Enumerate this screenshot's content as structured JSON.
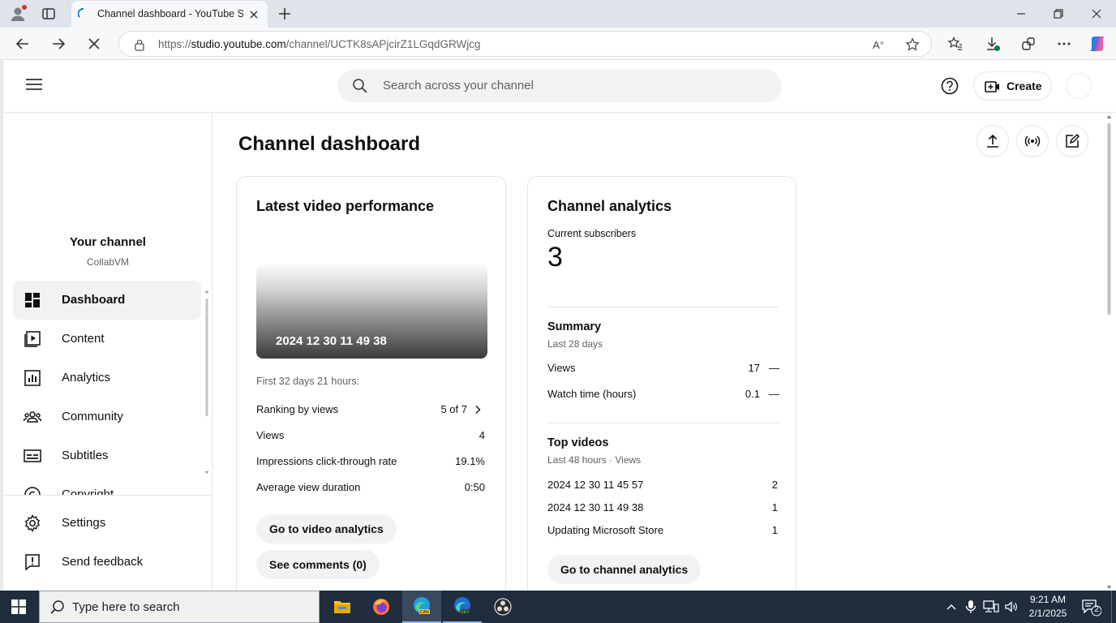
{
  "browser": {
    "tab_title": "Channel dashboard - YouTube Studio",
    "url_prefix": "https://",
    "url_host": "studio.youtube.com",
    "url_path": "/channel/UCTK8sAPjcirZ1LGqdGRWjcg"
  },
  "header": {
    "search_placeholder": "Search across your channel",
    "create_label": "Create"
  },
  "sidebar": {
    "channel_title": "Your channel",
    "channel_name": "CollabVM",
    "items": [
      {
        "label": "Dashboard",
        "icon": "dashboard-icon"
      },
      {
        "label": "Content",
        "icon": "content-icon"
      },
      {
        "label": "Analytics",
        "icon": "analytics-icon"
      },
      {
        "label": "Community",
        "icon": "community-icon"
      },
      {
        "label": "Subtitles",
        "icon": "subtitles-icon"
      },
      {
        "label": "Copyright",
        "icon": "copyright-icon"
      }
    ],
    "settings_label": "Settings",
    "feedback_label": "Send feedback"
  },
  "main": {
    "page_title": "Channel dashboard"
  },
  "latest_video": {
    "title": "Latest video performance",
    "video_title": "2024 12 30 11 49 38",
    "period": "First 32 days 21 hours:",
    "rows": [
      {
        "label": "Ranking by views",
        "value": "5 of 7"
      },
      {
        "label": "Views",
        "value": "4"
      },
      {
        "label": "Impressions click-through rate",
        "value": "19.1%"
      },
      {
        "label": "Average view duration",
        "value": "0:50"
      }
    ],
    "analytics_button": "Go to video analytics",
    "comments_button": "See comments (0)"
  },
  "channel_analytics": {
    "title": "Channel analytics",
    "subscribers_label": "Current subscribers",
    "subscribers_value": "3",
    "summary_title": "Summary",
    "summary_period": "Last 28 days",
    "summary_rows": [
      {
        "label": "Views",
        "value": "17",
        "trend": "—"
      },
      {
        "label": "Watch time (hours)",
        "value": "0.1",
        "trend": "—"
      }
    ],
    "top_videos_title": "Top videos",
    "top_videos_period": "Last 48 hours · Views",
    "top_videos": [
      {
        "title": "2024 12 30 11 45 57",
        "views": "2"
      },
      {
        "title": "2024 12 30 11 49 38",
        "views": "1"
      },
      {
        "title": "Updating Microsoft Store",
        "views": "1"
      }
    ],
    "analytics_button": "Go to channel analytics"
  },
  "taskbar": {
    "search_placeholder": "Type here to search",
    "time": "9:21 AM",
    "date": "2/1/2025",
    "notification_count": "2"
  },
  "colors": {
    "taskbar": "#1f2d3d",
    "accent": "#0f0f0f"
  }
}
